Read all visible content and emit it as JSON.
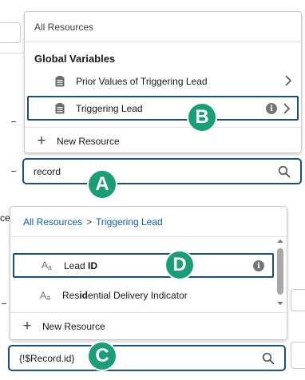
{
  "top_dropdown": {
    "header": "All Resources",
    "section_title": "Global Variables",
    "items": [
      {
        "label": "Prior Values of Triggering Lead",
        "icon": "clipboard-icon"
      },
      {
        "label": "Triggering Lead",
        "icon": "clipboard-icon",
        "selected": true
      }
    ],
    "new_resource": "New Resource"
  },
  "top_search": {
    "value": "record"
  },
  "bottom_dropdown": {
    "breadcrumb_root": "All Resources",
    "breadcrumb_separator": ">",
    "breadcrumb_current": "Triggering Lead",
    "items": [
      {
        "label_pre": "Lead ",
        "label_bold": "ID",
        "label_post": "",
        "icon": "text-field-icon",
        "selected": true
      },
      {
        "label_pre": "Res",
        "label_bold": "id",
        "label_post": "ential Delivery Indicator",
        "icon": "text-field-icon"
      }
    ],
    "new_resource": "New Resource"
  },
  "bottom_search": {
    "value": "{!$Record.id}"
  },
  "type_icon_text": {
    "main": "A",
    "sub": "a"
  },
  "background": {
    "partial_label": "ce"
  },
  "info_glyph": "i",
  "callouts": {
    "a": "A",
    "b": "B",
    "c": "C",
    "d": "D"
  },
  "colors": {
    "accent_border": "#1b4f82",
    "link": "#0b5cab",
    "callout": "#1a9e77"
  }
}
